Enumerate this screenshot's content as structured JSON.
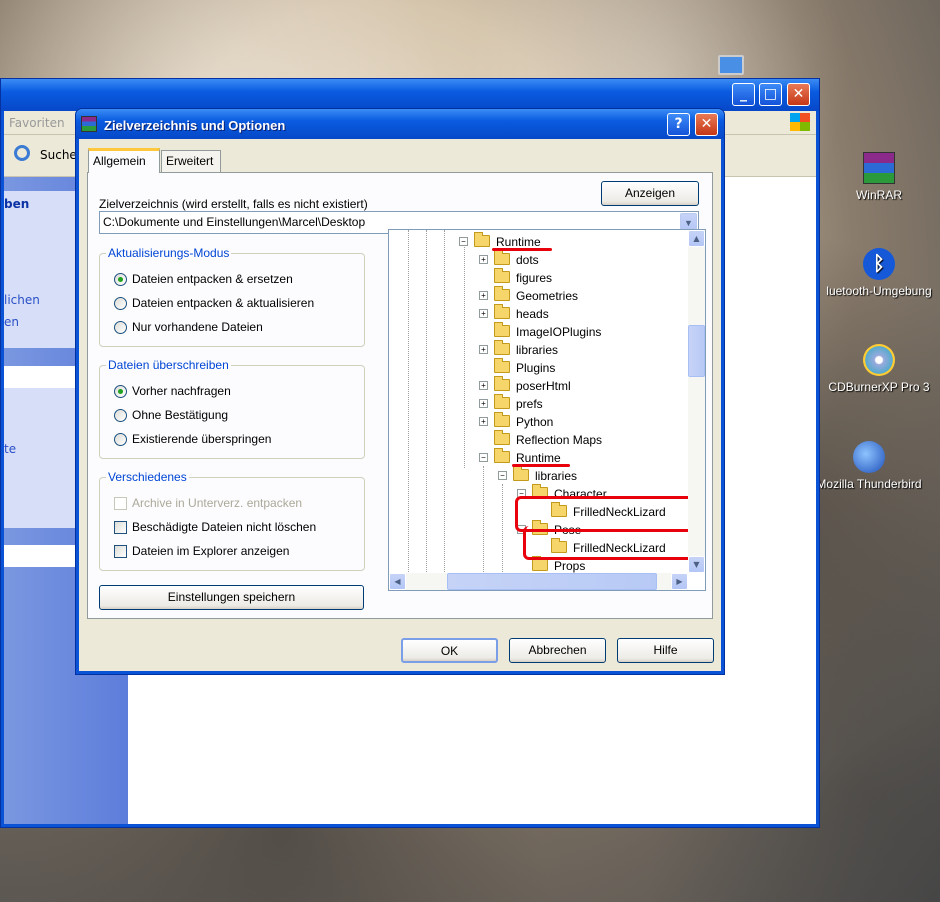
{
  "desktop": {
    "icons": [
      {
        "label": "WinRAR"
      },
      {
        "label": "luetooth-Umgebung"
      },
      {
        "label": "CDBurnerXP Pro 3"
      },
      {
        "label": "Mozilla Thunderbird"
      }
    ]
  },
  "explorer": {
    "menu_favoriten": "Favoriten",
    "toolbar_search": "Suche",
    "left_header": "ben",
    "left_link1": "lichen",
    "left_link2": "en",
    "left_link3": "te"
  },
  "dialog": {
    "title": "Zielverzeichnis und Optionen",
    "tabs": [
      "Allgemein",
      "Erweitert"
    ],
    "target_label": "Zielverzeichnis (wird erstellt, falls es nicht existiert)",
    "show_button": "Anzeigen",
    "target_path": "C:\\Dokumente und Einstellungen\\Marcel\\Desktop",
    "update_group": {
      "title": "Aktualisierungs-Modus",
      "options": [
        "Dateien entpacken & ersetzen",
        "Dateien entpacken & aktualisieren",
        "Nur vorhandene Dateien"
      ],
      "selected": 0
    },
    "overwrite_group": {
      "title": "Dateien überschreiben",
      "options": [
        "Vorher nachfragen",
        "Ohne Bestätigung",
        "Existierende überspringen"
      ],
      "selected": 0
    },
    "misc_group": {
      "title": "Verschiedenes",
      "options": [
        "Archive in Unterverz. entpacken",
        "Beschädigte Dateien nicht löschen",
        "Dateien im Explorer anzeigen"
      ]
    },
    "save_settings": "Einstellungen speichern",
    "ok": "OK",
    "cancel": "Abbrechen",
    "help": "Hilfe",
    "tree": [
      {
        "label": "Runtime",
        "pm": "−"
      },
      {
        "label": "dots",
        "pm": "+"
      },
      {
        "label": "figures",
        "pm": ""
      },
      {
        "label": "Geometries",
        "pm": "+"
      },
      {
        "label": "heads",
        "pm": "+"
      },
      {
        "label": "ImageIOPlugins",
        "pm": ""
      },
      {
        "label": "libraries",
        "pm": "+"
      },
      {
        "label": "Plugins",
        "pm": ""
      },
      {
        "label": "poserHtml",
        "pm": "+"
      },
      {
        "label": "prefs",
        "pm": "+"
      },
      {
        "label": "Python",
        "pm": "+"
      },
      {
        "label": "Reflection Maps",
        "pm": ""
      },
      {
        "label": "Runtime",
        "pm": "−"
      },
      {
        "label": "libraries",
        "pm": "−"
      },
      {
        "label": "Character",
        "pm": "−"
      },
      {
        "label": "FrilledNeckLizard",
        "pm": ""
      },
      {
        "label": "Pose",
        "pm": "−"
      },
      {
        "label": "FrilledNeckLizard",
        "pm": ""
      },
      {
        "label": "Props",
        "pm": ""
      }
    ]
  }
}
